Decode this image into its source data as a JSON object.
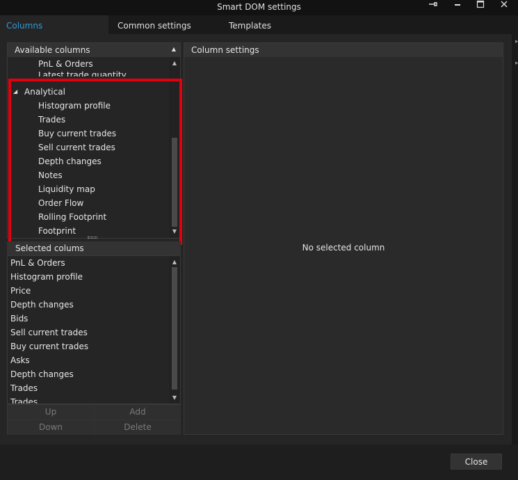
{
  "window": {
    "title": "Smart DOM settings",
    "pin_icon": "pin-icon",
    "minimize_icon": "minimize-icon",
    "maximize_icon": "maximize-icon",
    "close_icon": "close-icon"
  },
  "tabs": [
    {
      "label": "Columns",
      "active": true
    },
    {
      "label": "Common settings",
      "active": false
    },
    {
      "label": "Templates",
      "active": false
    }
  ],
  "available": {
    "header": "Available columns",
    "items_above": [
      "PnL & Orders",
      "Latest trade quantity"
    ],
    "group": "Analytical",
    "group_items": [
      "Histogram profile",
      "Trades",
      "Buy current trades",
      "Sell current trades",
      "Depth changes",
      "Notes",
      "Liquidity map",
      "Order Flow",
      "Rolling Footprint",
      "Footprint"
    ]
  },
  "selected": {
    "header": "Selected colums",
    "items": [
      "PnL & Orders",
      "Histogram profile",
      "Price",
      "Depth changes",
      "Bids",
      "Sell current trades",
      "Buy current trades",
      "Asks",
      "Depth changes",
      "Trades",
      "Trades"
    ]
  },
  "buttons": {
    "up": "Up",
    "add": "Add",
    "down": "Down",
    "delete": "Delete"
  },
  "column_settings": {
    "header": "Column settings",
    "empty_message": "No selected column"
  },
  "footer": {
    "close": "Close"
  },
  "colors": {
    "accent": "#2f9bd8",
    "highlight": "#e3000e"
  }
}
